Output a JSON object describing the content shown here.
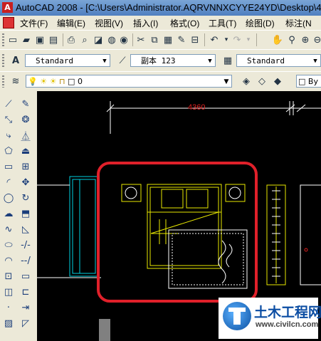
{
  "window": {
    "title": "AutoCAD 2008 - [C:\\Users\\Administrator.AQRVNNXCYYE24YD\\Desktop\\4-",
    "app_icon_letter": "A"
  },
  "menu": [
    {
      "label": "文件(F)"
    },
    {
      "label": "编辑(E)"
    },
    {
      "label": "视图(V)"
    },
    {
      "label": "插入(I)"
    },
    {
      "label": "格式(O)"
    },
    {
      "label": "工具(T)"
    },
    {
      "label": "绘图(D)"
    },
    {
      "label": "标注(N"
    }
  ],
  "styles_toolbar": {
    "text_style": "Standard",
    "dim_style": "副本 123",
    "table_style": "Standard"
  },
  "layers_toolbar": {
    "current_layer": "0",
    "bylayer_partial": "By"
  },
  "drawing": {
    "dimension_value": "4360",
    "dimension_color": "#e02020",
    "highlight_color": "#e0202a",
    "line_color_yellow": "#e8e800",
    "line_color_cyan": "#00d0e0",
    "line_color_white": "#ffffff"
  },
  "watermark": {
    "title": "土木工程网",
    "url": "www.civilcn.com"
  },
  "icons": {
    "standard_toolbar": [
      "new-icon",
      "open-icon",
      "save-icon",
      "print-icon",
      "preview-icon",
      "publish-icon",
      "cut-icon",
      "copy-icon",
      "paste-icon",
      "match-properties-icon",
      "block-editor-icon",
      "undo-icon",
      "redo-icon",
      "pan-icon",
      "zoom-icon"
    ],
    "left_toolbar": [
      "line-icon",
      "erase-icon",
      "polyline-icon",
      "copy-object-icon",
      "polygon-icon",
      "mirror-icon",
      "rectangle-icon",
      "offset-icon",
      "arc-icon",
      "array-icon",
      "circle-icon",
      "move-icon",
      "revision-cloud-icon",
      "rotate-icon",
      "spline-icon",
      "scale-icon",
      "ellipse-icon",
      "stretch-icon",
      "ellipse-arc-icon",
      "trim-icon",
      "insert-block-icon",
      "extend-icon",
      "make-block-icon",
      "break-icon",
      "point-icon",
      "join-icon",
      "hatch-icon",
      "chamfer-icon"
    ]
  }
}
